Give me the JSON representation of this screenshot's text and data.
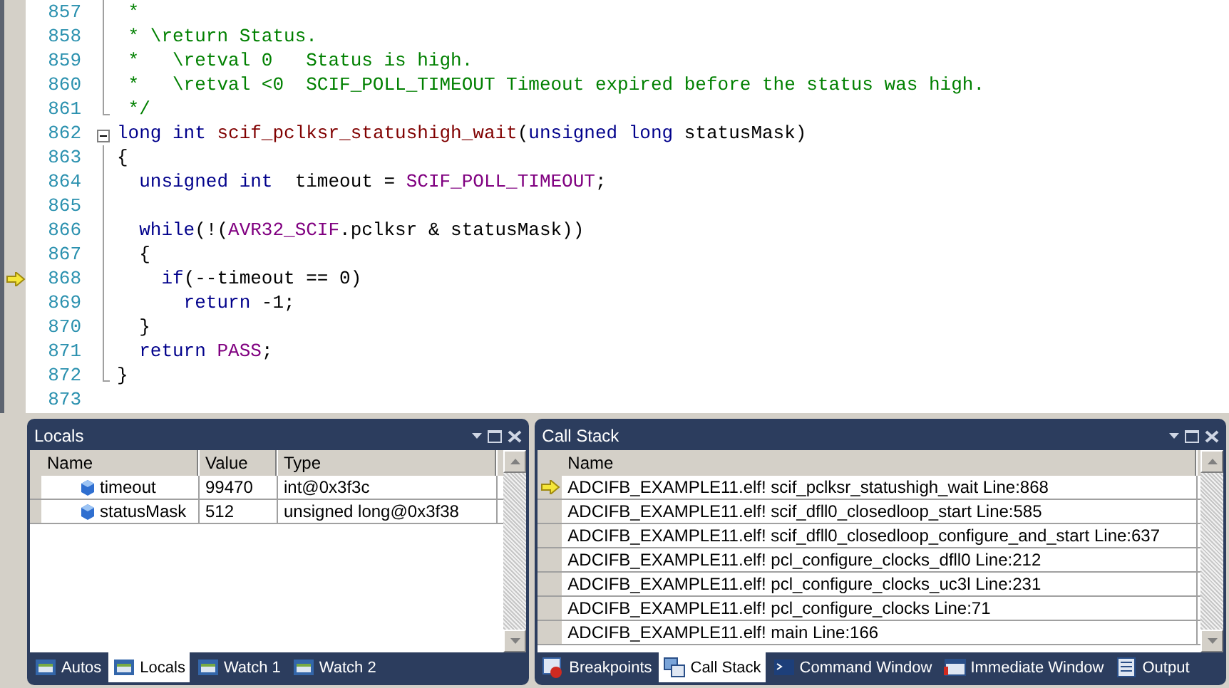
{
  "editor": {
    "lines": [
      {
        "number": "857",
        "current": false,
        "kind": "fold-line",
        "tokens": [
          {
            "kind": "comment",
            "text": " *"
          }
        ]
      },
      {
        "number": "858",
        "current": false,
        "kind": "fold-line",
        "tokens": [
          {
            "kind": "comment",
            "text": " * \\return Status."
          }
        ]
      },
      {
        "number": "859",
        "current": false,
        "kind": "fold-line",
        "tokens": [
          {
            "kind": "comment",
            "text": " *   \\retval 0   Status is high."
          }
        ]
      },
      {
        "number": "860",
        "current": false,
        "kind": "fold-line",
        "tokens": [
          {
            "kind": "comment",
            "text": " *   \\retval <0  SCIF_POLL_TIMEOUT Timeout expired before the status was high."
          }
        ]
      },
      {
        "number": "861",
        "current": false,
        "kind": "fold-end",
        "tokens": [
          {
            "kind": "comment",
            "text": " */"
          }
        ]
      },
      {
        "number": "862",
        "current": false,
        "kind": "fold-box",
        "expanded": true,
        "tokens": [
          {
            "kind": "keyword",
            "text": "long int"
          },
          {
            "kind": "function",
            "text": " scif_pclksr_statushigh_wait"
          },
          {
            "kind": "plain",
            "text": "("
          },
          {
            "kind": "keyword",
            "text": "unsigned long"
          },
          {
            "kind": "plain",
            "text": " statusMask)"
          }
        ]
      },
      {
        "number": "863",
        "current": false,
        "kind": "fold-line",
        "tokens": [
          {
            "kind": "plain",
            "text": "{"
          }
        ]
      },
      {
        "number": "864",
        "current": false,
        "kind": "fold-line",
        "tokens": [
          {
            "kind": "keyword",
            "text": "  unsigned int"
          },
          {
            "kind": "plain",
            "text": "  timeout = "
          },
          {
            "kind": "macro",
            "text": "SCIF_POLL_TIMEOUT"
          },
          {
            "kind": "plain",
            "text": ";"
          }
        ]
      },
      {
        "number": "865",
        "current": false,
        "kind": "fold-line"
      },
      {
        "number": "866",
        "current": false,
        "kind": "fold-line",
        "tokens": [
          {
            "kind": "keyword",
            "text": "  while"
          },
          {
            "kind": "plain",
            "text": "(!("
          },
          {
            "kind": "macro",
            "text": "AVR32_SCIF"
          },
          {
            "kind": "plain",
            "text": ".pclksr & statusMask))"
          }
        ]
      },
      {
        "number": "867",
        "current": false,
        "kind": "fold-line",
        "tokens": [
          {
            "kind": "plain",
            "text": "  {"
          }
        ]
      },
      {
        "number": "868",
        "current": true,
        "kind": "fold-line",
        "tokens": [
          {
            "kind": "keyword",
            "text": "    if"
          },
          {
            "kind": "plain",
            "text": "(--timeout == 0)"
          }
        ]
      },
      {
        "number": "869",
        "current": false,
        "kind": "fold-line",
        "tokens": [
          {
            "kind": "keyword",
            "text": "      return"
          },
          {
            "kind": "plain",
            "text": " -1;"
          }
        ]
      },
      {
        "number": "870",
        "current": false,
        "kind": "fold-line",
        "tokens": [
          {
            "kind": "plain",
            "text": "  }"
          }
        ]
      },
      {
        "number": "871",
        "current": false,
        "kind": "fold-line",
        "tokens": [
          {
            "kind": "keyword",
            "text": "  return"
          },
          {
            "kind": "macro",
            "text": " PASS"
          },
          {
            "kind": "plain",
            "text": ";"
          }
        ]
      },
      {
        "number": "872",
        "current": false,
        "kind": "fold-end",
        "tokens": [
          {
            "kind": "plain",
            "text": "}"
          }
        ]
      },
      {
        "number": "873",
        "current": false,
        "kind": "plain"
      }
    ]
  },
  "locals": {
    "title": "Locals",
    "columns": [
      "Name",
      "Value",
      "Type"
    ],
    "rows": [
      {
        "name": "timeout",
        "value": "99470",
        "type": "int@0x3f3c"
      },
      {
        "name": "statusMask",
        "value": "512",
        "type": "unsigned long@0x3f38"
      }
    ],
    "tabs": [
      {
        "label": "Autos",
        "selected": false
      },
      {
        "label": "Locals",
        "selected": true
      },
      {
        "label": "Watch 1",
        "selected": false
      },
      {
        "label": "Watch 2",
        "selected": false
      }
    ]
  },
  "call_stack": {
    "title": "Call Stack",
    "columns": [
      "Name"
    ],
    "rows": [
      {
        "name": "ADCIFB_EXAMPLE11.elf! scif_pclksr_statushigh_wait Line:868",
        "current": true
      },
      {
        "name": "ADCIFB_EXAMPLE11.elf! scif_dfll0_closedloop_start Line:585",
        "current": false
      },
      {
        "name": "ADCIFB_EXAMPLE11.elf! scif_dfll0_closedloop_configure_and_start Line:637",
        "current": false
      },
      {
        "name": "ADCIFB_EXAMPLE11.elf! pcl_configure_clocks_dfll0 Line:212",
        "current": false
      },
      {
        "name": "ADCIFB_EXAMPLE11.elf! pcl_configure_clocks_uc3l Line:231",
        "current": false
      },
      {
        "name": "ADCIFB_EXAMPLE11.elf! pcl_configure_clocks Line:71",
        "current": false
      },
      {
        "name": "ADCIFB_EXAMPLE11.elf! main Line:166",
        "current": false
      }
    ],
    "tabs": [
      {
        "label": "Breakpoints",
        "selected": false
      },
      {
        "label": "Call Stack",
        "selected": true
      },
      {
        "label": "Command Window",
        "selected": false
      },
      {
        "label": "Immediate Window",
        "selected": false
      },
      {
        "label": "Output",
        "selected": false
      }
    ]
  }
}
